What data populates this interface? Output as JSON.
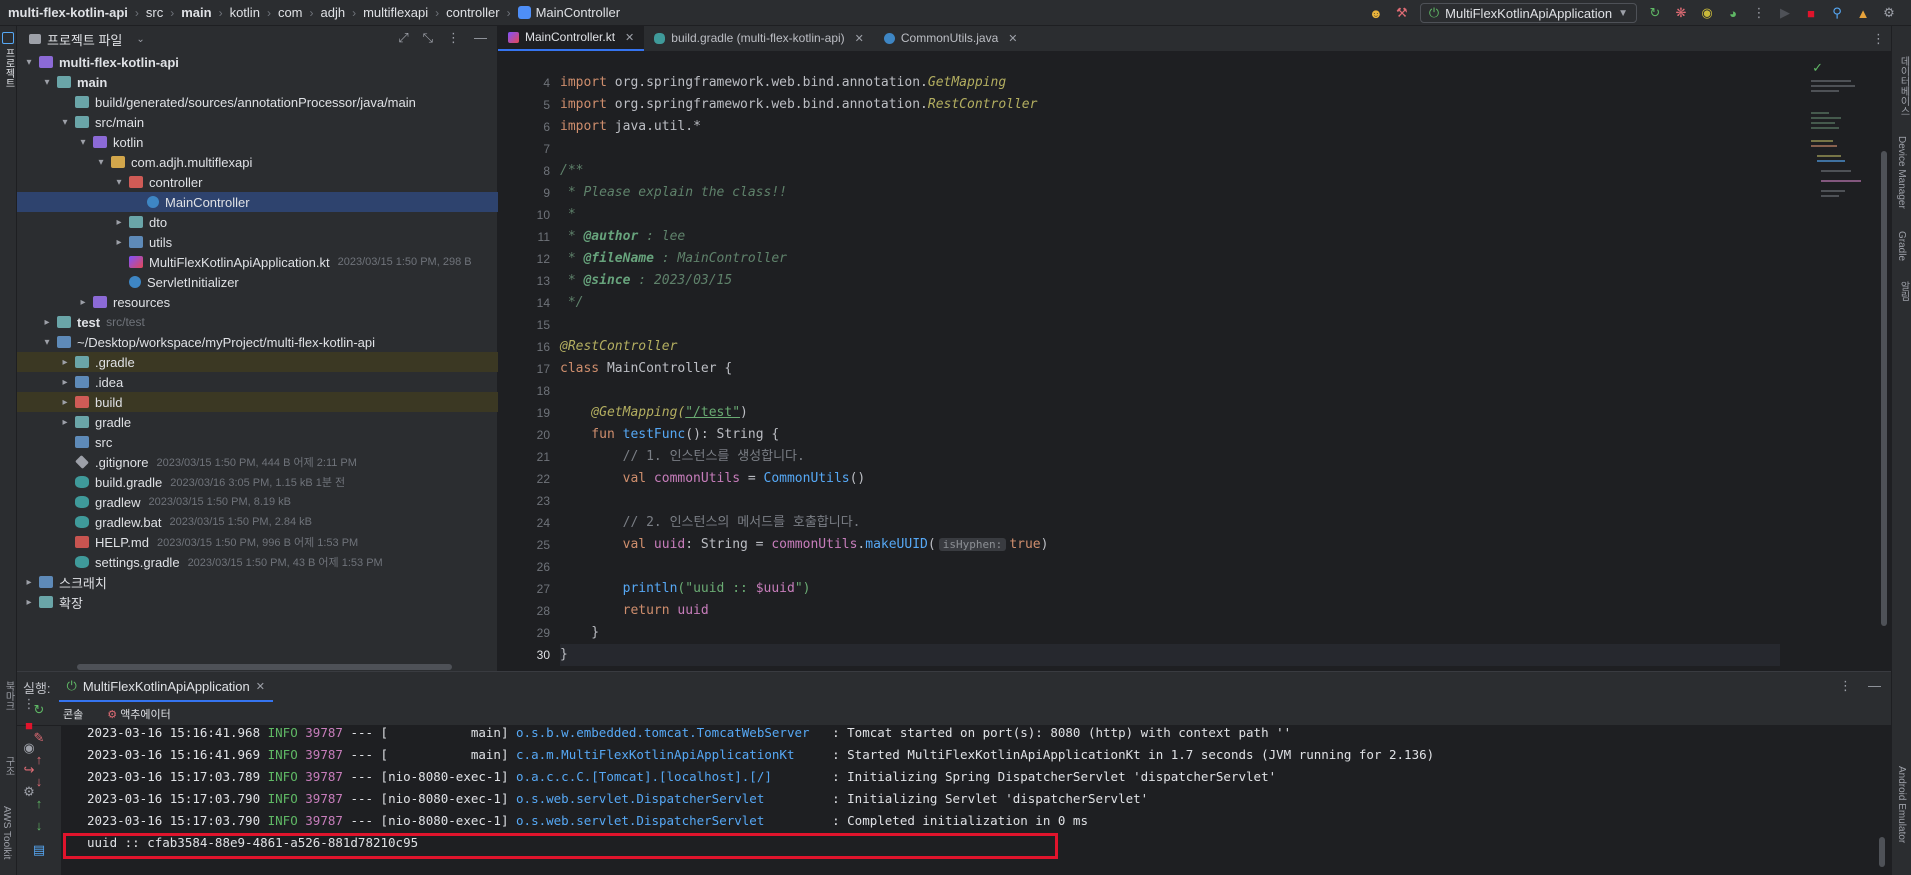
{
  "breadcrumb": [
    "multi-flex-kotlin-api",
    "src",
    "main",
    "kotlin",
    "com",
    "adjh",
    "multiflexapi",
    "controller",
    "MainController"
  ],
  "toolbar": {
    "run_config": "MultiFlexKotlinApiApplication"
  },
  "left_strip": {
    "project_label": "프로젝트",
    "bookmarks_label": "북마크",
    "structure_label": "구조",
    "aws_label": "AWS Toolkit"
  },
  "right_strip": {
    "notifications_label": "데이터베이스",
    "device_label": "Device Manager",
    "gradle_label": "Gradle",
    "alarm_label": "알림",
    "emulator_label": "Android Emulator"
  },
  "project": {
    "title": "프로젝트 파일",
    "tree": [
      {
        "label": "multi-flex-kotlin-api",
        "bold": true,
        "indent": 0,
        "arrow": "▾",
        "icon": "pfolder",
        "meta": ""
      },
      {
        "label": "main",
        "bold": true,
        "indent": 1,
        "arrow": "▾",
        "icon": "gfolder",
        "meta": ""
      },
      {
        "label": "build/generated/sources/annotationProcessor/java/main",
        "indent": 2,
        "arrow": "",
        "icon": "gfolder",
        "meta": ""
      },
      {
        "label": "src/main",
        "indent": 2,
        "arrow": "▾",
        "icon": "gfolder",
        "meta": ""
      },
      {
        "label": "kotlin",
        "indent": 3,
        "arrow": "▾",
        "icon": "pfolder",
        "meta": ""
      },
      {
        "label": "com.adjh.multiflexapi",
        "indent": 4,
        "arrow": "▾",
        "icon": "yfolder",
        "meta": ""
      },
      {
        "label": "controller",
        "indent": 5,
        "arrow": "▾",
        "icon": "rfolder",
        "meta": ""
      },
      {
        "label": "MainController",
        "indent": 6,
        "arrow": "",
        "icon": "class",
        "meta": "",
        "selected": true
      },
      {
        "label": "dto",
        "indent": 5,
        "arrow": "▸",
        "icon": "gfolder",
        "meta": ""
      },
      {
        "label": "utils",
        "indent": 5,
        "arrow": "▸",
        "icon": "folder",
        "meta": ""
      },
      {
        "label": "MultiFlexKotlinApiApplication.kt",
        "indent": 5,
        "arrow": "",
        "icon": "kt",
        "meta": "2023/03/15 1:50 PM, 298 B"
      },
      {
        "label": "ServletInitializer",
        "indent": 5,
        "arrow": "",
        "icon": "class",
        "meta": ""
      },
      {
        "label": "resources",
        "indent": 3,
        "arrow": "▸",
        "icon": "pfolder",
        "meta": ""
      },
      {
        "label": "test",
        "bold": true,
        "indent": 1,
        "arrow": "▸",
        "icon": "gfolder",
        "meta": "",
        "sub": "src/test"
      },
      {
        "label": "~/Desktop/workspace/myProject/multi-flex-kotlin-api",
        "indent": 1,
        "arrow": "▾",
        "icon": "folder",
        "meta": ""
      },
      {
        "label": ".gradle",
        "indent": 2,
        "arrow": "▸",
        "icon": "gfolder",
        "meta": "",
        "highlight": true
      },
      {
        "label": ".idea",
        "indent": 2,
        "arrow": "▸",
        "icon": "folder",
        "meta": ""
      },
      {
        "label": "build",
        "indent": 2,
        "arrow": "▸",
        "icon": "rfolder",
        "meta": "",
        "highlight": true
      },
      {
        "label": "gradle",
        "indent": 2,
        "arrow": "▸",
        "icon": "gfolder",
        "meta": ""
      },
      {
        "label": "src",
        "indent": 2,
        "arrow": "",
        "icon": "folder",
        "meta": ""
      },
      {
        "label": ".gitignore",
        "indent": 2,
        "arrow": "",
        "icon": "git",
        "meta": "2023/03/15 1:50 PM, 444 B 어제 2:11 PM"
      },
      {
        "label": "build.gradle",
        "indent": 2,
        "arrow": "",
        "icon": "gradle",
        "meta": "2023/03/16 3:05 PM, 1.15 kB 1분 전"
      },
      {
        "label": "gradlew",
        "indent": 2,
        "arrow": "",
        "icon": "gradle",
        "meta": "2023/03/15 1:50 PM, 8.19 kB"
      },
      {
        "label": "gradlew.bat",
        "indent": 2,
        "arrow": "",
        "icon": "gradle",
        "meta": "2023/03/15 1:50 PM, 2.84 kB"
      },
      {
        "label": "HELP.md",
        "indent": 2,
        "arrow": "",
        "icon": "md",
        "meta": "2023/03/15 1:50 PM, 996 B 어제 1:53 PM"
      },
      {
        "label": "settings.gradle",
        "indent": 2,
        "arrow": "",
        "icon": "gradle",
        "meta": "2023/03/15 1:50 PM, 43 B 어제 1:53 PM"
      },
      {
        "label": "스크래치",
        "indent": 0,
        "arrow": "▸",
        "icon": "folder",
        "meta": ""
      },
      {
        "label": "확장",
        "indent": 0,
        "arrow": "▸",
        "icon": "gfolder",
        "meta": ""
      }
    ]
  },
  "editor": {
    "tabs": [
      {
        "label": "MainController.kt",
        "active": true
      },
      {
        "label": "build.gradle (multi-flex-kotlin-api)",
        "active": false
      },
      {
        "label": "CommonUtils.java",
        "active": false
      }
    ],
    "line_numbers": [
      "4",
      "5",
      "6",
      "7",
      "8",
      "9",
      "10",
      "11",
      "12",
      "13",
      "14",
      "15",
      "16",
      "17",
      "18",
      "19",
      "20",
      "21",
      "22",
      "23",
      "24",
      "25",
      "26",
      "27",
      "28",
      "29",
      "30"
    ],
    "code": {
      "l4": [
        "import ",
        "org.springframework.web.bind.annotation.",
        "GetMapping"
      ],
      "l5": [
        "import ",
        "org.springframework.web.bind.annotation.",
        "RestController"
      ],
      "l6": [
        "import ",
        "java.util.*"
      ],
      "l8": "/**",
      "l9": " * Please explain the class!!",
      "l10": " *",
      "l11": [
        " * ",
        "@author",
        " : lee"
      ],
      "l12": [
        " * ",
        "@fileName",
        " : MainController"
      ],
      "l13": [
        " * ",
        "@since",
        " : 2023/03/15"
      ],
      "l14": " */",
      "l16": "@RestController",
      "l17": [
        "class ",
        "MainController",
        " {"
      ],
      "l19": [
        "    @GetMapping(",
        "\"/test\"",
        ")"
      ],
      "l20": [
        "    fun ",
        "testFunc",
        "(): String {"
      ],
      "l21": "        // 1. 인스턴스를 생성합니다.",
      "l22": [
        "        val ",
        "commonUtils",
        " = ",
        "CommonUtils",
        "()"
      ],
      "l24": "        // 2. 인스턴스의 메서드를 호출합니다.",
      "l25": [
        "        val ",
        "uuid",
        ": String = ",
        "commonUtils",
        ".",
        "makeUUID",
        "(",
        "isHyphen:",
        "true",
        ")"
      ],
      "l27": [
        "        ",
        "println",
        "(\"uuid :: ",
        "$uuid",
        "\")"
      ],
      "l28": [
        "        return ",
        "uuid"
      ],
      "l29": "    }",
      "l30": "}"
    }
  },
  "run": {
    "label": "실행:",
    "tab": "MultiFlexKotlinApiApplication",
    "subtabs": [
      "콘솔",
      "액추에이터"
    ],
    "console": [
      {
        "ts": "2023-03-16 15:16:41.968",
        "level": "INFO",
        "pid": "39787",
        "thread": "--- [           main]",
        "logger": "o.s.b.w.embedded.tomcat.TomcatWebServer ",
        "msg": " : Tomcat started on port(s): 8080 (http) with context path ''"
      },
      {
        "ts": "2023-03-16 15:16:41.969",
        "level": "INFO",
        "pid": "39787",
        "thread": "--- [           main]",
        "logger": "c.a.m.MultiFlexKotlinApiApplicationKt   ",
        "msg": " : Started MultiFlexKotlinApiApplicationKt in 1.7 seconds (JVM running for 2.136)"
      },
      {
        "ts": "2023-03-16 15:17:03.789",
        "level": "INFO",
        "pid": "39787",
        "thread": "--- [nio-8080-exec-1]",
        "logger": "o.a.c.c.C.[Tomcat].[localhost].[/]      ",
        "msg": " : Initializing Spring DispatcherServlet 'dispatcherServlet'"
      },
      {
        "ts": "2023-03-16 15:17:03.790",
        "level": "INFO",
        "pid": "39787",
        "thread": "--- [nio-8080-exec-1]",
        "logger": "o.s.web.servlet.DispatcherServlet       ",
        "msg": " : Initializing Servlet 'dispatcherServlet'"
      },
      {
        "ts": "2023-03-16 15:17:03.790",
        "level": "INFO",
        "pid": "39787",
        "thread": "--- [nio-8080-exec-1]",
        "logger": "o.s.web.servlet.DispatcherServlet       ",
        "msg": " : Completed initialization in 0 ms"
      }
    ],
    "uuid_output": "uuid :: cfab3584-88e9-4861-a526-881d78210c95"
  },
  "colors": {
    "accent": "#3574f0",
    "highlight_box": "#e0142c"
  }
}
